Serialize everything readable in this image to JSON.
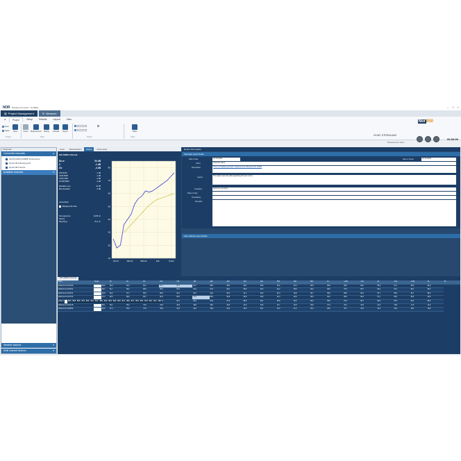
{
  "app": {
    "title": "Building Acoustics - NorBEE",
    "logo": "NOR",
    "tabs": [
      {
        "label": "Project Management"
      },
      {
        "label": "Measure"
      }
    ]
  },
  "ribbon": {
    "tabs": [
      "Project",
      "Setup",
      "Results",
      "Layout",
      "View"
    ],
    "buttons": [
      "New",
      "Open",
      "Save",
      "Import",
      "Measurement",
      "Rating",
      "Activate",
      "Export",
      "Table"
    ],
    "groups": [
      "Project",
      "Data",
      "Measure",
      "Report",
      "Table"
    ],
    "device": {
      "name": "HCWC STERNLANG",
      "state": "Measurement done",
      "time": "00:00:00"
    },
    "brand": {
      "prefix": "Nor",
      "model": "850"
    }
  },
  "left_panel": {
    "title": "Channels",
    "connected_label": "Connected channels",
    "devices": [
      "Nor150 [2456] (NOR850 Performance)",
      "[1] Nor HR-6 Receiving FR",
      "[2] Nor HR-6 Source"
    ],
    "available_label": "Available channels",
    "weather_label": "Weather stations",
    "multi_label": "Multi channel devices"
  },
  "subtabs": [
    "Level",
    "Reverberation",
    "Rating",
    "Audio setup"
  ],
  "result": {
    "title": "ISO 16283-1 Normal",
    "params": [
      {
        "name": "Dn,w",
        "value": "54 dB"
      },
      {
        "name": "C",
        "value": "-1 dB"
      },
      {
        "name": "Ctr",
        "value": "-4 dB"
      },
      {
        "name": "C50-3150",
        "value": "-1 dB"
      },
      {
        "name": "C100-5000",
        "value": "-1 dB"
      },
      {
        "name": "Ctr50-3150",
        "value": "-4 dB"
      },
      {
        "name": "Ctr100-5000",
        "value": "-4 dB"
      },
      {
        "name": "Deviation sum",
        "value": "31 dB"
      },
      {
        "name": "Max deviation",
        "value": "6 dB"
      }
    ],
    "curve_label": "Curve fitted",
    "background_label": "Background noise",
    "bottom_params": [
      {
        "name": "Test specimen",
        "value": "10,85 m²"
      },
      {
        "name": "Source",
        "value": ""
      },
      {
        "name": "Receiving",
        "value": "70,1 m³"
      }
    ],
    "chart_data": {
      "type": "line",
      "x_ticks": [
        "50 Hz",
        "160 Hz",
        "500 Hz",
        "1k6",
        "5 kHz"
      ],
      "y_ticks": [
        80,
        70,
        60,
        50,
        40,
        30,
        20,
        10
      ],
      "ylim": [
        10,
        85
      ],
      "series": [
        {
          "color": "#3b3bd0",
          "values": [
            25,
            18,
            20,
            36,
            40,
            44,
            52,
            56,
            58,
            62,
            61,
            62,
            64,
            66,
            68,
            70,
            73,
            76
          ]
        },
        {
          "color": "#c9bd3a",
          "values": [
            null,
            null,
            null,
            30,
            33,
            36,
            39,
            42,
            45,
            48,
            51,
            53,
            55,
            56,
            57,
            58,
            59,
            60
          ]
        }
      ]
    }
  },
  "report": {
    "title": "Report Information",
    "std_section": "Standard report fields",
    "fields": {
      "date_of_test_label": "Date of test",
      "date_of_test": "24.10.2020",
      "date_of_report_label": "Date of report",
      "date_of_report": "24.10.2020",
      "client_label": "Client",
      "client": "Norsonic client",
      "description_label": "Description",
      "description": "This is a building acoustic measurement following ISO 16283",
      "layout_label": "Layout",
      "layout": "The object was the wall separating the two rooms",
      "company_label": "Company",
      "company": "Norsonic company",
      "place_label": "Place of test",
      "place": "",
      "uncertainty_label": "Uncertainty",
      "uncertainty": "",
      "remarks_label": "Remarks",
      "remarks": ""
    },
    "user_section": "User defined report fields"
  },
  "table": {
    "tab_label": "ISO 16283-1 Normal",
    "columns": [
      "Name",
      "Single",
      "50",
      "63",
      "80",
      "100",
      "125",
      "160",
      "200",
      "250",
      "315",
      "400",
      "500",
      "630",
      "800",
      "1k",
      "1.25k",
      "1.6k",
      "2k",
      "2.5k",
      "3.15k",
      "4k",
      "5k"
    ],
    "rows": [
      {
        "group": true,
        "name": "Source",
        "single": "",
        "vals": [
          "81,3",
          "87,7",
          "88,4",
          "89,3",
          "82,3",
          "86,1",
          "90,3",
          "88,1",
          "89,6",
          "90,5",
          "91,2",
          "90,4",
          "90,5",
          "90,1",
          "88,4",
          "89,3",
          "87,2",
          "88,3",
          "84,3",
          "85,7"
        ]
      },
      {
        "group": true,
        "name": "Pos 1",
        "single": "96,7",
        "vals": [
          "81,3",
          "87,4",
          "88,3",
          "89,3",
          "82,3",
          "86,1",
          "90,3",
          "88,1",
          "89,6",
          "90,5",
          "91,2",
          "90,4",
          "90,5",
          "90,1",
          "88,4",
          "89,3",
          "87,2",
          "88,3",
          "84,3",
          "85,7"
        ]
      },
      {
        "name": "2020-10-24 12:53:09",
        "single": "86,8",
        "vals": [
          "82,0",
          "81,4",
          "82,1",
          "82,3",
          "89,2",
          "81,7",
          "88,5",
          "89,0",
          "90,1",
          "90,8",
          "91,5",
          "90,4",
          "90,5",
          "89,8",
          "88,3",
          "89,0",
          "86,9",
          "87,7",
          "85,9",
          "84,9"
        ]
      },
      {
        "name": "2020-10-24 12:54:01",
        "single": "96,7",
        "vals": [
          "81,7",
          "89,1",
          "88,0",
          "89,3",
          "82,9",
          "81,4",
          "87,8",
          "88,1",
          "89,6",
          "90,3",
          "91,2",
          "89,5",
          "90,0",
          "89,6",
          "87,9",
          "88,7",
          "86,4",
          "87,4",
          "85,1",
          "85,3"
        ]
      },
      {
        "name": "2020-10-24 12:55:14",
        "single": "96,9",
        "vals": [
          "83,2",
          "87,7",
          "86,3",
          "88,5",
          "82,4",
          "81,2",
          "90,4",
          "89,0",
          "91,1",
          "90,6",
          "91,3",
          "90,8",
          "90,7",
          "89,9",
          "88,5",
          "89,2",
          "87,1",
          "88,3",
          "84,7",
          "85,6"
        ]
      },
      {
        "group": true,
        "name": "Pos 2",
        "single": "96,7",
        "vals": [
          "81,6",
          "87,4",
          "85,9",
          "89,9",
          "82,7",
          "81,4",
          "88,4",
          "88,4",
          "89,4",
          "90,6",
          "91,1",
          "90,6",
          "90,3",
          "89,9",
          "88,2",
          "89,0",
          "86,8",
          "87,8",
          "84,5",
          "85,3"
        ]
      },
      {
        "name": "2020-10-24 12:57:22",
        "single": "97,2",
        "vals": [
          "82,5",
          "88,0",
          "86,7",
          "90,2",
          "83,0",
          "81,9",
          "89,0",
          "88,9",
          "89,9",
          "90,8",
          "91,4",
          "90,9",
          "90,6",
          "90,2",
          "88,5",
          "89,3",
          "87,1",
          "88,1",
          "84,8",
          "85,6"
        ]
      },
      {
        "name": "2020-10-24 12:58:35",
        "single": "96,3",
        "vals": [
          "80,7",
          "86,9",
          "85,1",
          "89,6",
          "82,4",
          "80,9",
          "87,8",
          "87,9",
          "88,9",
          "90,4",
          "90,8",
          "90,3",
          "90,0",
          "89,6",
          "87,9",
          "88,7",
          "86,5",
          "87,5",
          "84,2",
          "85,0"
        ]
      },
      {
        "group": true,
        "name": "Receiving",
        "single": "",
        "vals": [
          "56,8",
          "55,6",
          "47,5",
          "45,2",
          "41,2",
          "40,2",
          "38,6",
          "34,3",
          "33,3",
          "32,8",
          "32,0",
          "31,1",
          "29,9",
          "27,7",
          "25,4",
          "23,2",
          "21,9",
          "20,1",
          "18,1",
          "16,5"
        ]
      },
      {
        "group": true,
        "name": "Pos 1",
        "single": "58,3",
        "vals": [
          "56,8",
          "55,6",
          "47,5",
          "45,2",
          "41,2",
          "40,2",
          "38,6",
          "34,3",
          "33,3",
          "32,8",
          "32,0",
          "31,1",
          "29,9",
          "27,7",
          "25,4",
          "23,2",
          "21,9",
          "20,1",
          "18,1",
          "16,5"
        ]
      },
      {
        "name": "2020-10-24 13:04:18",
        "single": "58,1",
        "vals": [
          "56,1",
          "55,2",
          "47,0",
          "44,8",
          "40,9",
          "39,8",
          "38,2",
          "33,9",
          "33,0",
          "32,5",
          "31,7",
          "30,8",
          "29,6",
          "27,4",
          "25,1",
          "22,9",
          "21,6",
          "19,8",
          "17,8",
          "16,2"
        ]
      },
      {
        "name": "2020-10-24 13:05:02",
        "single": "58,5",
        "vals": [
          "57,4",
          "55,9",
          "47,9",
          "45,6",
          "41,5",
          "40,5",
          "38,9",
          "34,6",
          "33,6",
          "33,1",
          "32,3",
          "31,4",
          "30,2",
          "28,0",
          "25,7",
          "23,5",
          "22,2",
          "20,4",
          "18,4",
          "16,8"
        ]
      }
    ]
  },
  "colors": {
    "panel_dark": "#1c3e66",
    "panel_mid": "#27496f",
    "accent": "#2e6ea8",
    "chart_series": "#3b3bd0",
    "chart_reference": "#c9bd3a"
  }
}
